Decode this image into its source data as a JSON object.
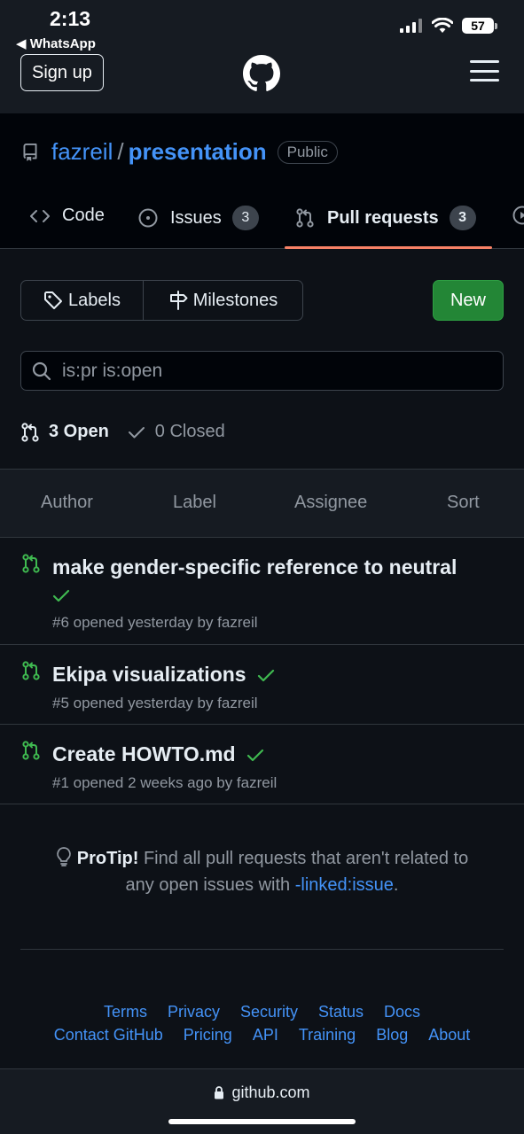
{
  "status_bar": {
    "time": "2:13",
    "back_app": "◀ WhatsApp",
    "battery": "57"
  },
  "header": {
    "signup_label": "Sign up"
  },
  "repo": {
    "owner": "fazreil",
    "separator": "/",
    "name": "presentation",
    "visibility": "Public"
  },
  "tabs": [
    {
      "label": "Code"
    },
    {
      "label": "Issues",
      "count": "3"
    },
    {
      "label": "Pull requests",
      "count": "3",
      "active": true
    }
  ],
  "filters": {
    "labels": "Labels",
    "milestones": "Milestones",
    "new_label": "New"
  },
  "search": {
    "value": "is:pr is:open"
  },
  "states": {
    "open": "3 Open",
    "closed": "0 Closed"
  },
  "sort_bar": [
    "Author",
    "Label",
    "Assignee",
    "Sort"
  ],
  "pull_requests": [
    {
      "title": "make gender-specific reference to neutral",
      "meta": "#6 opened yesterday by fazreil",
      "status": "check"
    },
    {
      "title": "Ekipa visualizations",
      "meta": "#5 opened yesterday by fazreil",
      "status": "check"
    },
    {
      "title": "Create HOWTO.md",
      "meta": "#1 opened 2 weeks ago by fazreil",
      "status": "check"
    }
  ],
  "protip": {
    "label": "ProTip!",
    "text": " Find all pull requests that aren't related to any open issues with ",
    "link": "-linked:issue",
    "end": "."
  },
  "footer": {
    "row1": [
      "Terms",
      "Privacy",
      "Security",
      "Status",
      "Docs"
    ],
    "row2": [
      "Contact GitHub",
      "Pricing",
      "API",
      "Training",
      "Blog",
      "About"
    ]
  },
  "url_bar": {
    "domain": "github.com"
  },
  "colors": {
    "accent_link": "#4493f8",
    "success": "#238636",
    "active_tab": "#f78166",
    "check": "#3fb950"
  }
}
